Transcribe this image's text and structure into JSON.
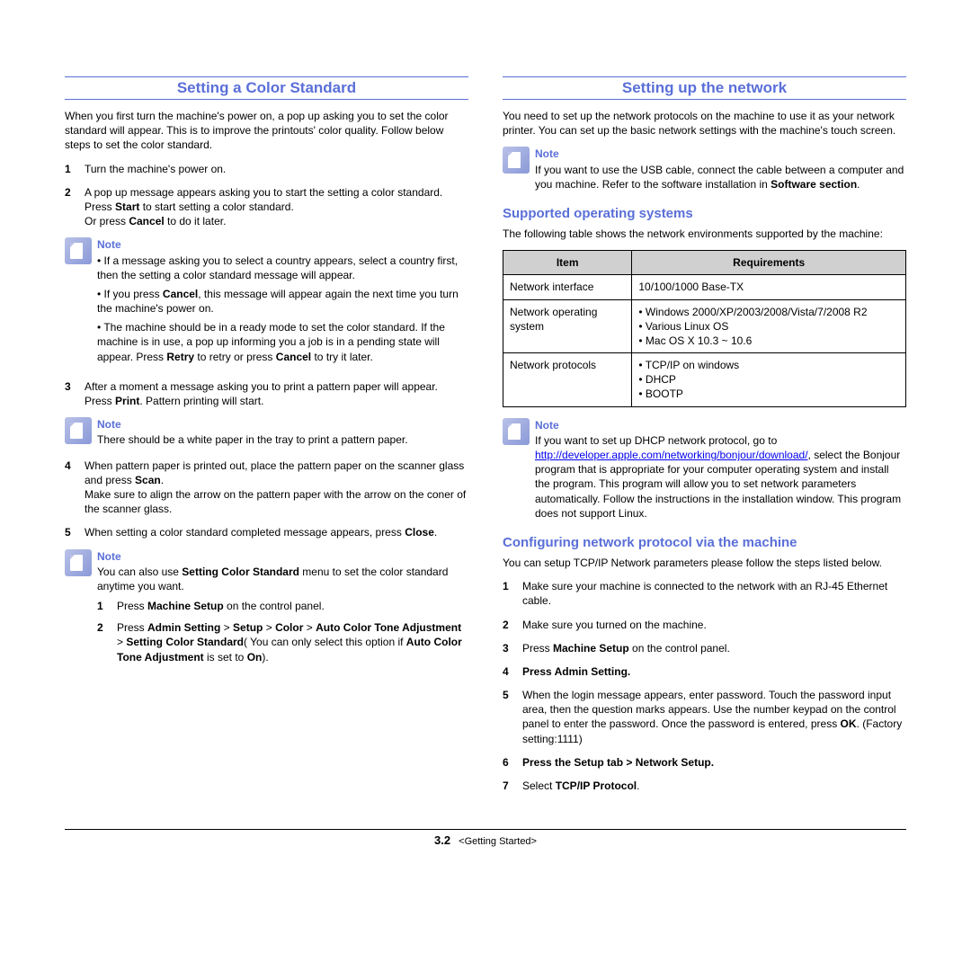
{
  "left": {
    "title": "Setting a Color Standard",
    "intro": "When you first turn the machine's power on, a pop up asking you to set the color standard will appear. This is to improve the printouts' color quality. Follow below steps to set the color standard.",
    "s1": "Turn the machine's power on.",
    "s2a": "A pop up message appears asking you to start  the setting a color standard.",
    "s2b": "Press ",
    "s2b_b": "Start",
    "s2c": " to start setting a color standard.",
    "s2d": "Or press ",
    "s2d_b": "Cancel",
    "s2e": " to do it later.",
    "note1_t": "Note",
    "note1_1": "• If a message asking you to select a country appears, select a country first, then the setting a color standard message will appear.",
    "note1_2a": "• If you press ",
    "note1_2b": "Cancel",
    "note1_2c": ", this message will appear again the next time you turn the machine's power on.",
    "note1_3a": "• The machine should be in a ready mode to set the color standard. If the machine is in use, a pop up informing you a job is in a pending state will appear. Press ",
    "note1_3b": "Retry",
    "note1_3c": " to retry or press ",
    "note1_3d": "Cancel",
    "note1_3e": " to try it later.",
    "s3a": "After a moment a message asking you to print a pattern paper will appear.",
    "s3b": "Press ",
    "s3b_b": "Print",
    "s3c": ". Pattern printing will start.",
    "note2_t": "Note",
    "note2": "There should be a white paper in the tray to print a pattern paper.",
    "s4a": "When pattern paper is printed out, place the pattern paper on the scanner glass and press ",
    "s4a_b": "Scan",
    "s4a2": ".",
    "s4b": "Make sure to align the arrow on the pattern paper with the arrow on the coner of the scanner glass.",
    "s5a": "When setting a color standard completed message appears, press ",
    "s5a_b": "Close",
    "s5a2": ".",
    "note3_t": "Note",
    "note3a": "You can also use ",
    "note3b": "Setting Color Standard",
    "note3c": " menu to set the color standard anytime you want.",
    "sub1a": "Press ",
    "sub1b": "Machine Setup",
    "sub1c": " on the control panel.",
    "sub2a": "Press ",
    "sub2b": "Admin Setting",
    "sub2c": " > ",
    "sub2d": "Setup",
    "sub2e": " > ",
    "sub2f": "Color",
    "sub2g": " >  ",
    "sub2h": "Auto Color Tone Adjustment",
    "sub2i": " > ",
    "sub2j": "Setting Color Standard",
    "sub2k": "( You can only select this option if  ",
    "sub2l": "Auto Color Tone Adjustment",
    "sub2m": " is set to ",
    "sub2n": "On",
    "sub2o": ")."
  },
  "right": {
    "title": "Setting up the network",
    "intro": "You need to set up the network protocols on the machine to use it as your network printer. You can set up the basic network settings with the machine's touch screen.",
    "note1_t": "Note",
    "note1a": "If you want to use the USB cable, connect the cable between a computer and you machine. Refer to the software installation in ",
    "note1b": "Software section",
    "note1c": ".",
    "h2a": "Supported operating systems",
    "tbl_intro": "The following table shows the network environments supported by the machine:",
    "th1": "Item",
    "th2": "Requirements",
    "r1c1": "Network interface",
    "r1c2": "10/100/1000 Base-TX",
    "r2c1": "Network operating system",
    "r2l1": "Windows 2000/XP/2003/2008/Vista/7/2008 R2",
    "r2l2": "Various Linux OS",
    "r2l3": "Mac OS X 10.3 ~ 10.6",
    "r3c1": "Network protocols",
    "r3l1": "TCP/IP on windows",
    "r3l2": "DHCP",
    "r3l3": "BOOTP",
    "note2_t": "Note",
    "note2a": "If you want to set up DHCP network protocol, go to ",
    "note2_link": "http://developer.apple.com/networking/bonjour/download/",
    "note2b": ", select the Bonjour program that is appropriate for your computer operating system and install the program. This program will allow you to set network parameters automatically. Follow the instructions in the installation window. This program does not support Linux.",
    "h2b": "Configuring network protocol via the machine",
    "conf_intro": "You can setup TCP/IP Network parameters please follow the steps listed below.",
    "c1": "Make sure your machine is connected to the network with an RJ-45 Ethernet cable.",
    "c2": "Make sure you turned on the machine.",
    "c3a": "Press ",
    "c3b": "Machine Setup",
    "c3c": " on the control panel.",
    "c4a": "Press ",
    "c4b": "Admin Setting",
    "c4c": ".",
    "c5a": "When the login message appears, enter password. Touch the password input area, then the question marks appears. Use the number keypad on the control panel to enter the password. Once the password is entered, press ",
    "c5b": "OK",
    "c5c": ". (Factory setting:1111)",
    "c6a": "Press the ",
    "c6b": "Setup",
    "c6c": " tab > ",
    "c6d": "Network Setup",
    "c6e": ".",
    "c7a": "Select ",
    "c7b": "TCP/IP Protocol",
    "c7c": "."
  },
  "footer": {
    "page": "3.2",
    "section": "<Getting Started>"
  }
}
